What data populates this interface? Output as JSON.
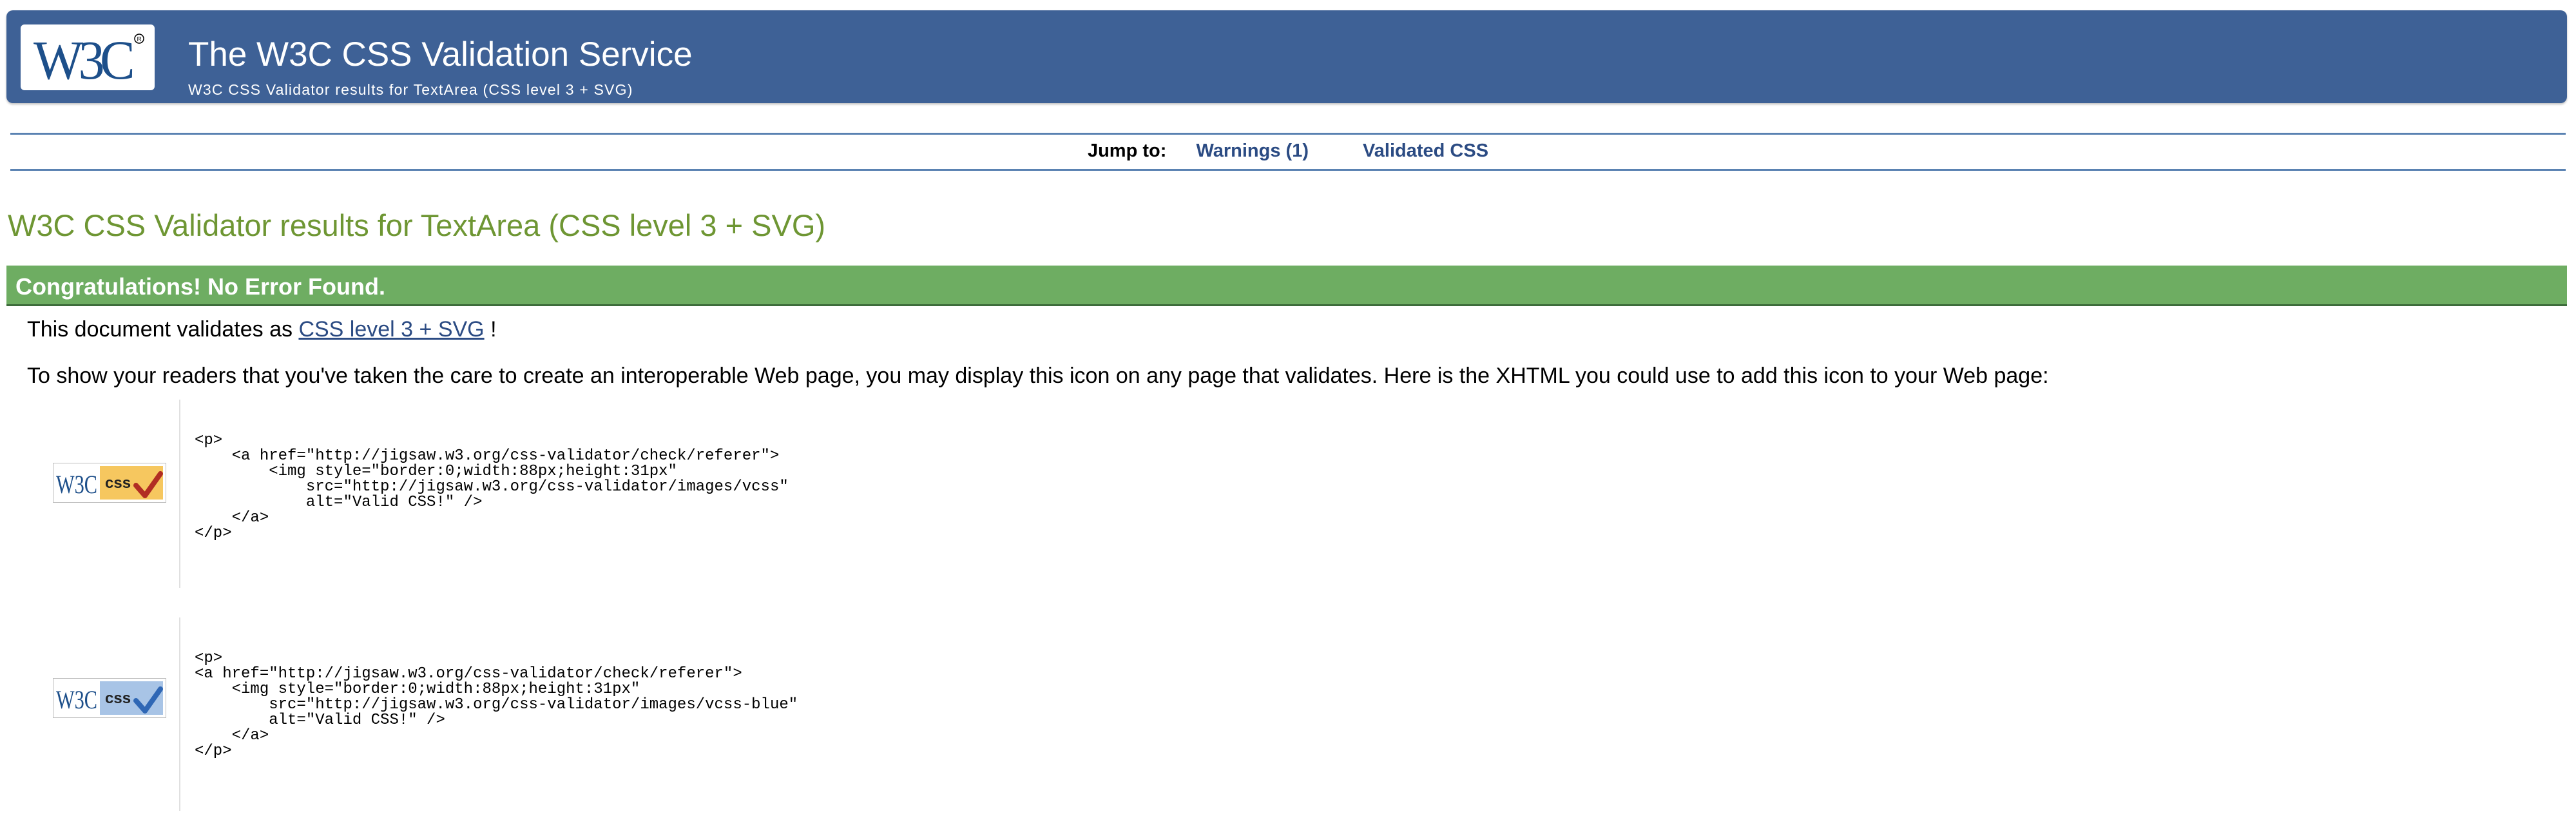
{
  "banner": {
    "title": "The W3C CSS Validation Service",
    "subtitle": "W3C CSS Validator results for TextArea (CSS level 3 + SVG)",
    "logo_text": "W3C",
    "logo_icon": "w3c-logo",
    "bg_color": "#3e6196"
  },
  "jumpbar": {
    "label": "Jump to:",
    "links": [
      {
        "label": "Warnings (1)"
      },
      {
        "label": "Validated CSS"
      }
    ],
    "link_color": "#2b4b83"
  },
  "results": {
    "heading": "W3C CSS Validator results for TextArea (CSS level 3 + SVG)",
    "heading_color": "#6e9633",
    "congrats": "Congratulations! No Error Found.",
    "congrats_color": "#6ead62",
    "validates_prefix": "This document validates as",
    "validates_link": "CSS level 3 + SVG",
    "validates_suffix": "!",
    "readers_text": "To show your readers that you've taken the care to create an interoperable Web page, you may display this icon on any page that validates. Here is the XHTML you could use to add this icon to your Web page:"
  },
  "badges": [
    {
      "icon": "valid-css-badge-gold",
      "logo_text": "W3C",
      "badge_text": "css",
      "accent": "#f6c75f",
      "check_color": "#b12d23",
      "code": "<p>\n    <a href=\"http://jigsaw.w3.org/css-validator/check/referer\">\n        <img style=\"border:0;width:88px;height:31px\"\n            src=\"http://jigsaw.w3.org/css-validator/images/vcss\"\n            alt=\"Valid CSS!\" />\n    </a>\n</p>"
    },
    {
      "icon": "valid-css-badge-blue",
      "logo_text": "W3C",
      "badge_text": "css",
      "accent": "#a8c4e6",
      "check_color": "#2f67b5",
      "code": "<p>\n<a href=\"http://jigsaw.w3.org/css-validator/check/referer\">\n    <img style=\"border:0;width:88px;height:31px\"\n        src=\"http://jigsaw.w3.org/css-validator/images/vcss-blue\"\n        alt=\"Valid CSS!\" />\n    </a>\n</p>"
    }
  ]
}
